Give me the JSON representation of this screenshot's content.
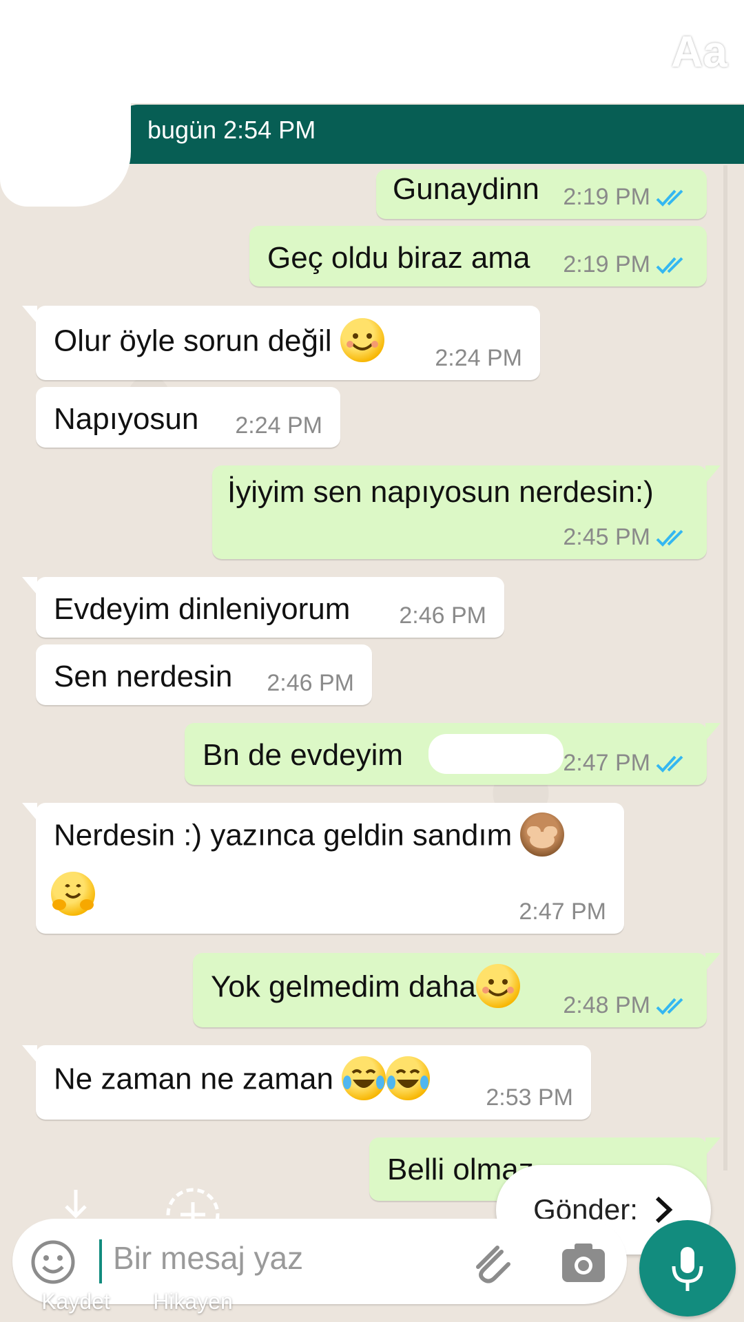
{
  "header": {
    "date_label": "bugün 2:54 PM",
    "tools": {
      "sticker_icon": "sticker-icon",
      "pen_icon": "pen-icon",
      "text_tool_label": "Aa"
    }
  },
  "messages": [
    {
      "dir": "out",
      "text": "Gunaydinn",
      "time": "2:19 PM",
      "read": true
    },
    {
      "dir": "out",
      "text": "Geç oldu biraz ama",
      "time": "2:19 PM",
      "read": true
    },
    {
      "dir": "in",
      "text": "Olur öyle sorun değil",
      "emoji": "smiling-face-emoji",
      "time": "2:24 PM"
    },
    {
      "dir": "in",
      "text": "Napıyosun",
      "time": "2:24 PM"
    },
    {
      "dir": "out",
      "text": "İyiyim sen napıyosun nerdesin:)",
      "time": "2:45 PM",
      "read": true
    },
    {
      "dir": "in",
      "text": "Evdeyim dinleniyorum",
      "time": "2:46 PM"
    },
    {
      "dir": "in",
      "text": "Sen nerdesin",
      "time": "2:46 PM"
    },
    {
      "dir": "out",
      "text": "Bn de evdeyim",
      "redacted": true,
      "time": "2:47 PM",
      "read": true
    },
    {
      "dir": "in",
      "text": "Nerdesin :) yazınca geldin sandım",
      "emoji": "see-no-evil-monkey-emoji",
      "emoji2": "hugging-face-emoji",
      "time": "2:47 PM"
    },
    {
      "dir": "out",
      "text": "Yok gelmedim daha",
      "emoji": "smiling-face-emoji",
      "time": "2:48 PM",
      "read": true
    },
    {
      "dir": "in",
      "text": "Ne zaman ne zaman",
      "emoji": "tears-of-joy-emoji",
      "time": "2:53 PM"
    },
    {
      "dir": "out",
      "text": "Belli olmaz"
    }
  ],
  "composer": {
    "placeholder": "Bir mesaj yaz"
  },
  "send_to": {
    "label": "Gönder:"
  },
  "story_actions": {
    "save_label": "Kaydet",
    "story_label": "Hikayen"
  }
}
